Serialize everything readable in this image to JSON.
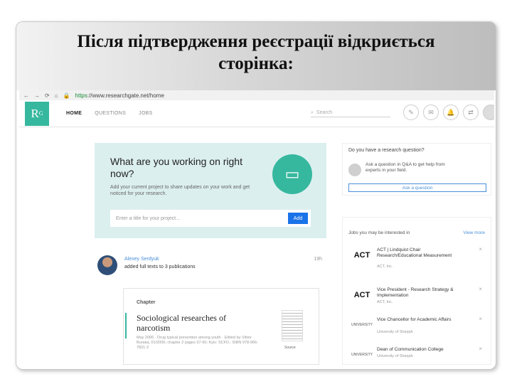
{
  "slide": {
    "title_line1": "Після підтвердження реєстрації відкриється",
    "title_line2": "сторінка:"
  },
  "browser": {
    "url_scheme": "https",
    "url_rest": "://www.researchgate.net/home",
    "nav_icons": [
      "back-icon",
      "forward-icon",
      "reload-icon",
      "home-icon",
      "lock-icon"
    ]
  },
  "nav": {
    "logo": "R",
    "logo_sup": "G",
    "links": [
      "HOME",
      "QUESTIONS",
      "JOBS"
    ],
    "search_placeholder": "Search"
  },
  "project": {
    "title": "What are you working on right now?",
    "description": "Add your current project to share updates on your work and get noticed for your research.",
    "input_placeholder": "Enter a title for your project...",
    "add_label": "Add"
  },
  "question": {
    "title": "Do you have a research question?",
    "text": "Ask a question in Q&A to get help from experts in your field.",
    "button": "Ask a question"
  },
  "jobs": {
    "header": "Jobs you may be interested in",
    "view_more": "View more",
    "items": [
      {
        "logo": "ACT",
        "title": "ACT | Lindquist Chair Research/Educational Measurement",
        "org": "ACT, Inc."
      },
      {
        "logo": "ACT",
        "title": "Vice President - Research Strategy & Implementation",
        "org": "ACT, Inc."
      },
      {
        "logo": "UNIVERSITY",
        "title": "Vice Chancellor for Academic Affairs",
        "org": "University of Sharjah"
      },
      {
        "logo": "UNIVERSITY",
        "title": "Dean of Communication College",
        "org": "University of Sharjah"
      }
    ]
  },
  "feed": {
    "author": "Alexey Serdyuk",
    "action": "added full texts to 3 publications",
    "time": "19h"
  },
  "publication": {
    "type": "Chapter",
    "title": "Sociological researches of narcotism",
    "meta": "May 2006 · Drug typical prevention among youth · Edited by Viktor Buraka, 01/2006; chapter 2 pages 37-60; Kyiv: SCFD.; ISBN 978-966-7821-2",
    "source": "Source"
  },
  "colors": {
    "brand": "#36b89f",
    "link": "#4a8fd9",
    "button": "#1a73e8"
  }
}
